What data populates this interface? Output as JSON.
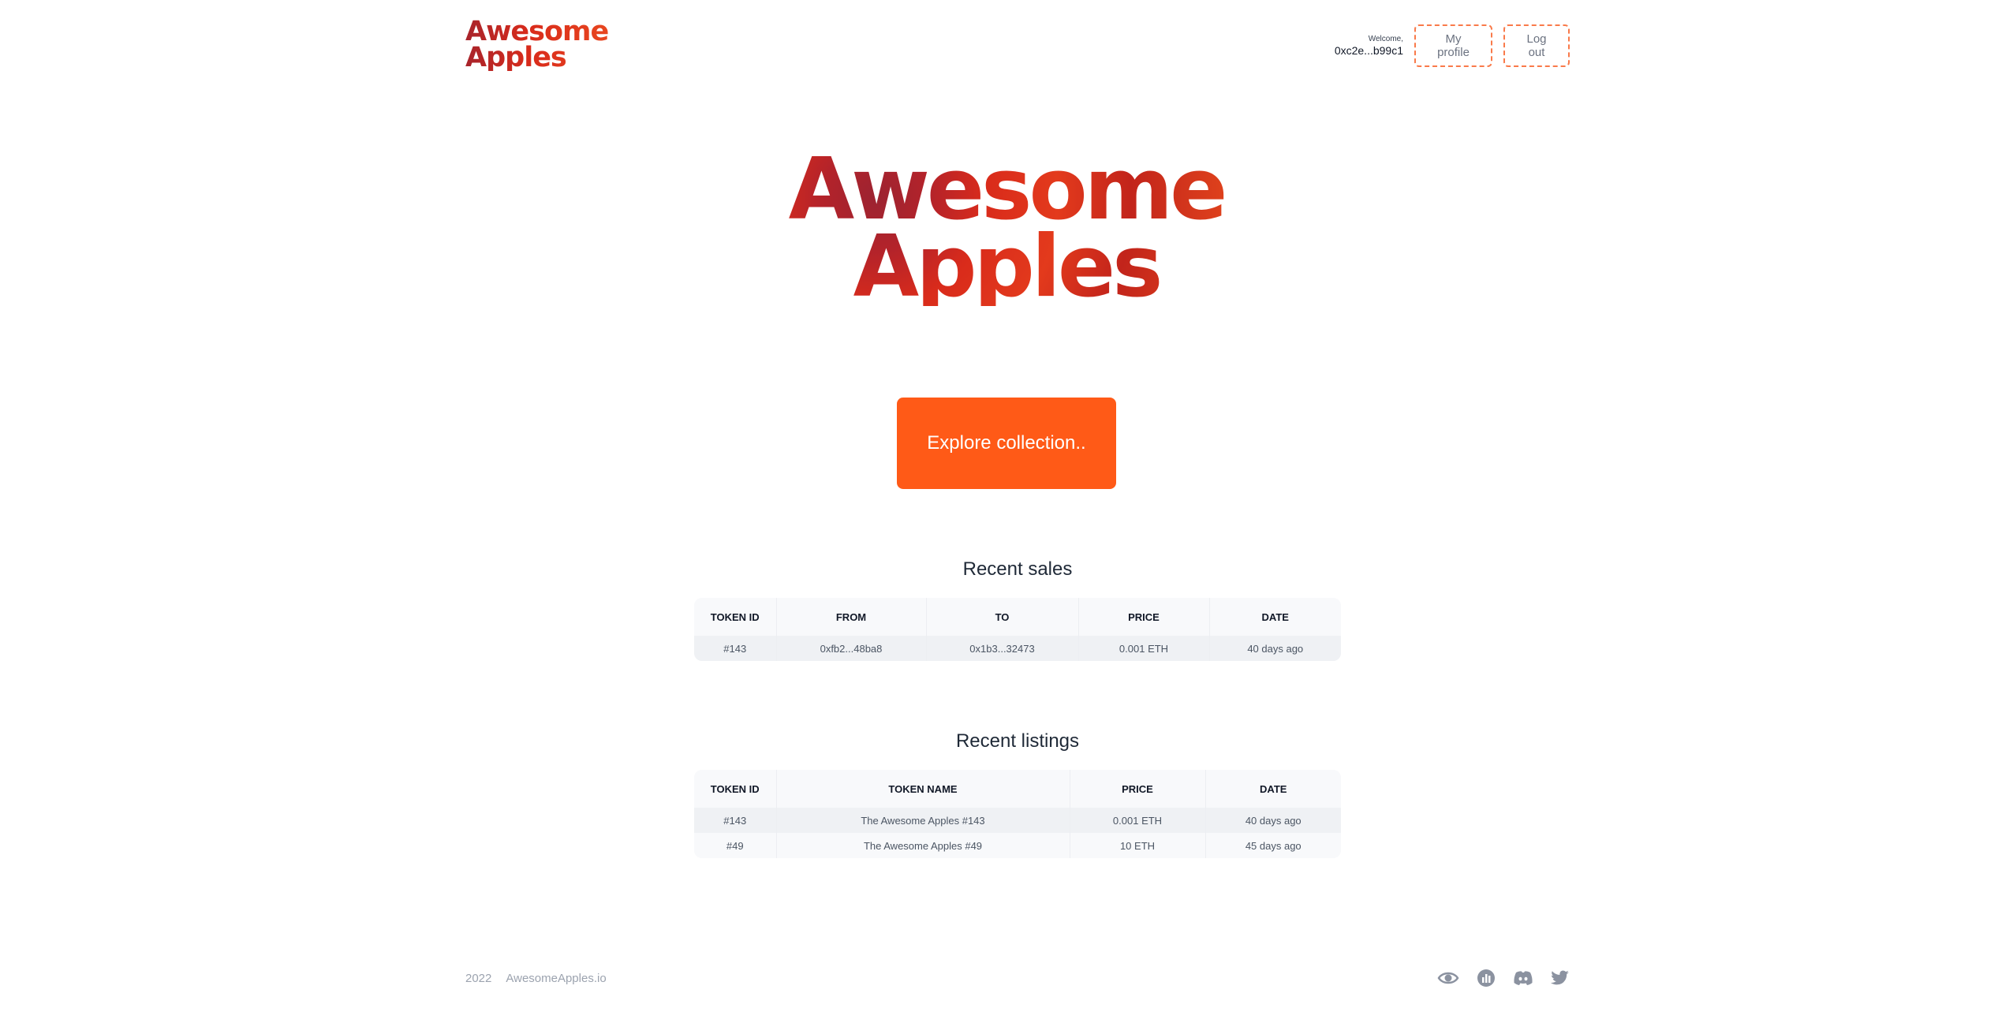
{
  "header": {
    "logo_line1": "Awesome",
    "logo_line2": "Apples",
    "welcome_label": "Welcome,",
    "wallet_address": "0xc2e...b99c1",
    "profile_button": "My profile",
    "logout_button": "Log out"
  },
  "hero": {
    "title_line1": "Awesome",
    "title_line2": "Apples",
    "cta_label": "Explore collection.."
  },
  "recent_sales": {
    "title": "Recent sales",
    "columns": [
      "TOKEN ID",
      "FROM",
      "TO",
      "PRICE",
      "DATE"
    ],
    "rows": [
      [
        "#143",
        "0xfb2...48ba8",
        "0x1b3...32473",
        "0.001 ETH",
        "40 days ago"
      ]
    ]
  },
  "recent_listings": {
    "title": "Recent listings",
    "columns": [
      "TOKEN ID",
      "TOKEN NAME",
      "PRICE",
      "DATE"
    ],
    "rows": [
      [
        "#143",
        "The Awesome Apples #143",
        "0.001 ETH",
        "40 days ago"
      ],
      [
        "#49",
        "The Awesome Apples #49",
        "10 ETH",
        "45 days ago"
      ]
    ]
  },
  "footer": {
    "year": "2022",
    "site": "AwesomeApples.io",
    "icons": [
      "eye-icon",
      "chart-icon",
      "discord-icon",
      "twitter-icon"
    ]
  },
  "colors": {
    "brand": "#d92b1b",
    "cta": "#ff5a17",
    "outline": "#f97a4a"
  }
}
